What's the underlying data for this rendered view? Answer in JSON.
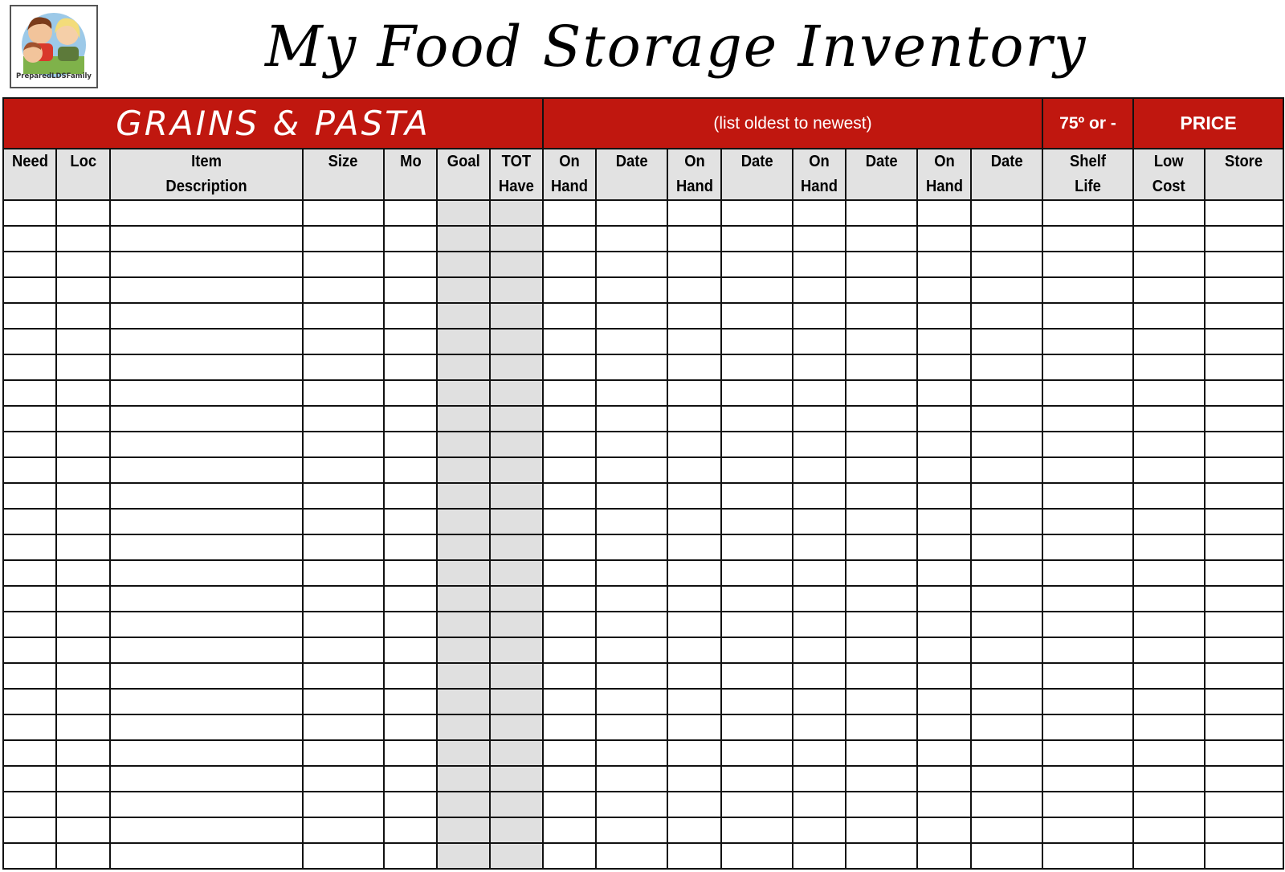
{
  "header": {
    "logo_text": "PreparedLDSFamily",
    "title": "My Food Storage Inventory"
  },
  "band": {
    "category": "GRAINS & PASTA",
    "note": "(list oldest to newest)",
    "shelf_note": "75º or -",
    "price": "PRICE"
  },
  "columns": [
    {
      "label": "Need",
      "shaded": false
    },
    {
      "label": "Loc",
      "shaded": false
    },
    {
      "label": "Item\nDescription",
      "shaded": false
    },
    {
      "label": "Size",
      "shaded": false
    },
    {
      "label": "Mo",
      "shaded": false
    },
    {
      "label": "Goal",
      "shaded": true
    },
    {
      "label": "TOT\nHave",
      "shaded": true
    },
    {
      "label": "On\nHand",
      "shaded": false
    },
    {
      "label": "Date",
      "shaded": false
    },
    {
      "label": "On\nHand",
      "shaded": false
    },
    {
      "label": "Date",
      "shaded": false
    },
    {
      "label": "On\nHand",
      "shaded": false
    },
    {
      "label": "Date",
      "shaded": false
    },
    {
      "label": "On\nHand",
      "shaded": false
    },
    {
      "label": "Date",
      "shaded": false
    },
    {
      "label": "Shelf\nLife",
      "shaded": false
    },
    {
      "label": "Low\nCost",
      "shaded": false
    },
    {
      "label": "Store",
      "shaded": false
    }
  ],
  "row_count": 26,
  "colors": {
    "band_red": "#c0170f",
    "header_gray": "#e2e2e2",
    "shaded_column": "#e0e0e0"
  }
}
